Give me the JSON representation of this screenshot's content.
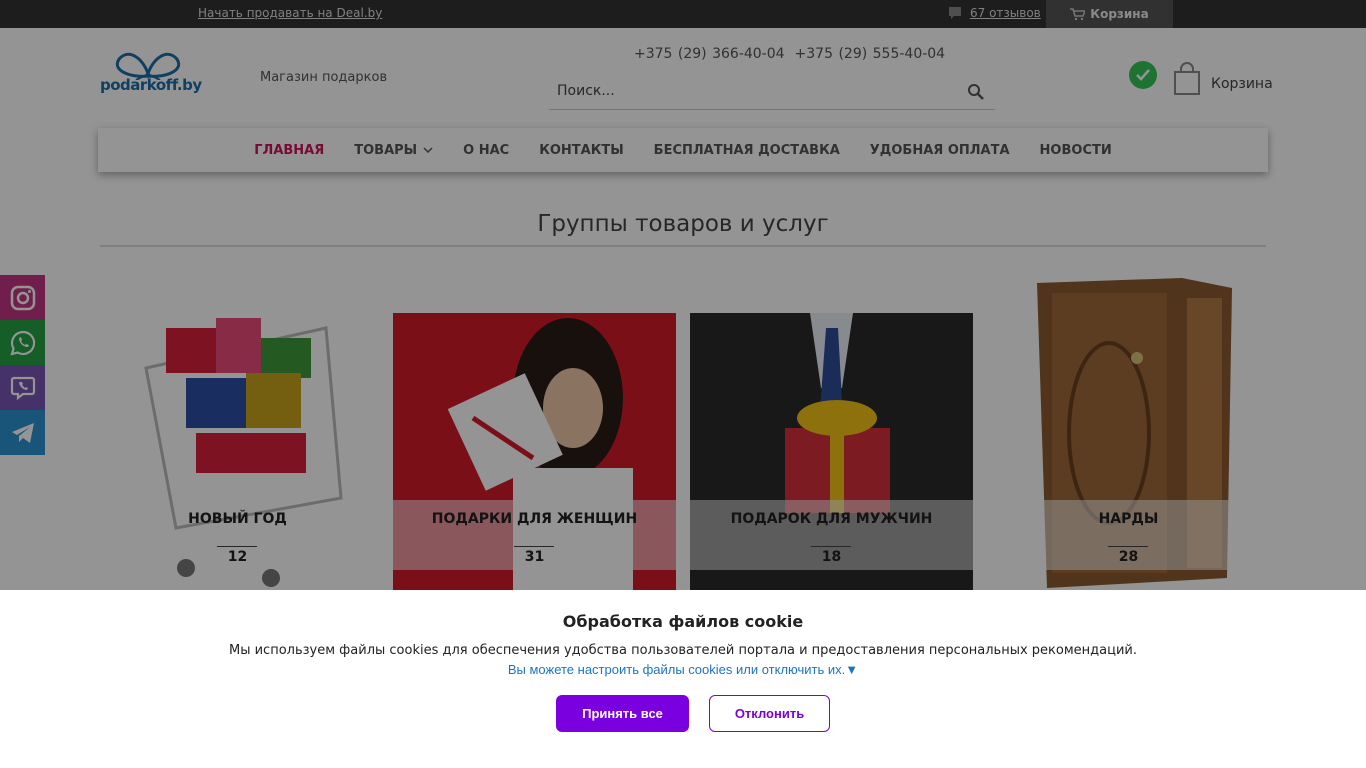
{
  "topbar": {
    "sell_link": "Начать продавать на Deal.by",
    "reviews_link": "67 отзывов",
    "cart_label": "Корзина"
  },
  "header": {
    "logo_text": "podarkoff.by",
    "tagline": "Магазин подарков",
    "phones": [
      "+375 (29) 366-40-04",
      "+375 (29) 555-40-04"
    ],
    "search_placeholder": "Поиск...",
    "cart_label": "Корзина"
  },
  "nav": {
    "items": [
      {
        "label": "Главная",
        "active": true
      },
      {
        "label": "Товары",
        "has_dropdown": true
      },
      {
        "label": "О нас"
      },
      {
        "label": "Контакты"
      },
      {
        "label": "Бесплатная доставка"
      },
      {
        "label": "Удобная оплата"
      },
      {
        "label": "Новости"
      }
    ]
  },
  "section": {
    "title": "Группы товаров и услуг",
    "categories": [
      {
        "name": "Новый год",
        "count": "12"
      },
      {
        "name": "Подарки для женщин",
        "count": "31"
      },
      {
        "name": "Подарок для мужчин",
        "count": "18"
      },
      {
        "name": "Нарды",
        "count": "28"
      }
    ]
  },
  "social": [
    "instagram-icon",
    "whatsapp-icon",
    "viber-icon",
    "telegram-icon"
  ],
  "cookie": {
    "title": "Обработка файлов cookie",
    "description": "Мы используем файлы cookies для обеспечения удобства пользователей портала и предоставления персональных рекомендаций.",
    "settings_link": "Вы можете настроить файлы cookies или отключить их.▼",
    "accept_label": "Принять все",
    "decline_label": "Отклонить"
  },
  "colors": {
    "accent": "#d0105c",
    "cookie_button": "#7a00e0",
    "topbar": "#333333"
  }
}
